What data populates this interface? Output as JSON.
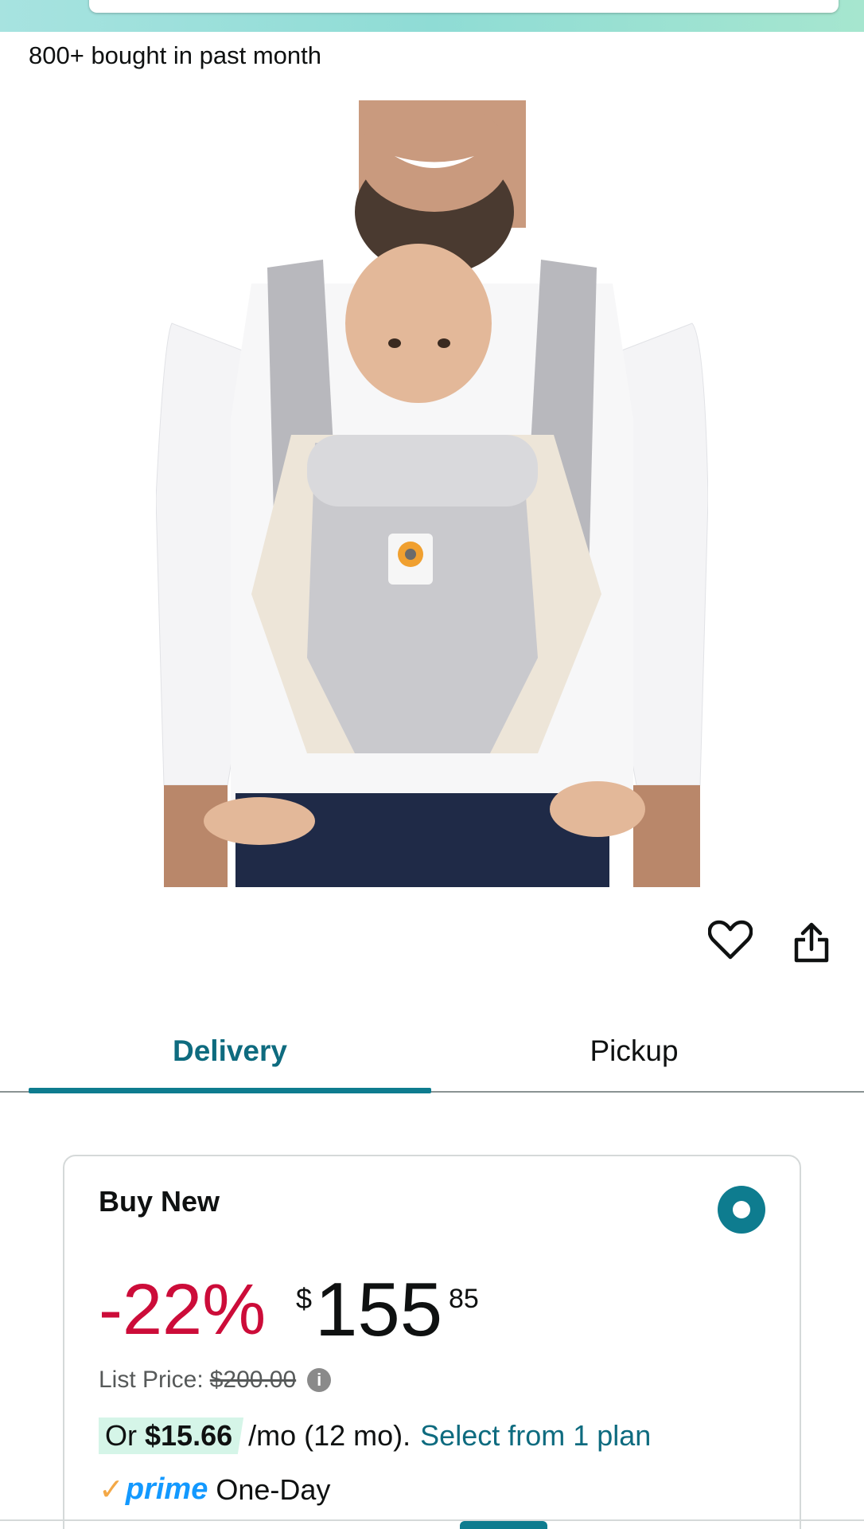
{
  "social_proof": {
    "text": "800+ bought in past month"
  },
  "product": {
    "image_alt": "Baby carrier worn by smiling man holding baby"
  },
  "actions": {
    "heart_icon": "heart-icon",
    "share_icon": "share-icon"
  },
  "tabs": [
    {
      "label": "Delivery",
      "selected": true
    },
    {
      "label": "Pickup",
      "selected": false
    }
  ],
  "buy_box": {
    "title": "Buy New",
    "discount": "-22%",
    "currency_symbol": "$",
    "price_whole": "155",
    "price_fraction": "85",
    "list_price_label": "List Price:",
    "list_price_value": "$200.00",
    "installment_prefix": "Or",
    "installment_amount": "$15.66",
    "installment_term": "/mo (12 mo).",
    "installment_link": "Select from 1 plan",
    "prime_check": "✓",
    "prime_label": "prime",
    "prime_speed": "One-Day"
  },
  "colors": {
    "accent_teal": "#0e7c8f",
    "discount_red": "#cc0c39",
    "prime_blue": "#1399ff",
    "installment_bg": "#d5f5e8"
  }
}
